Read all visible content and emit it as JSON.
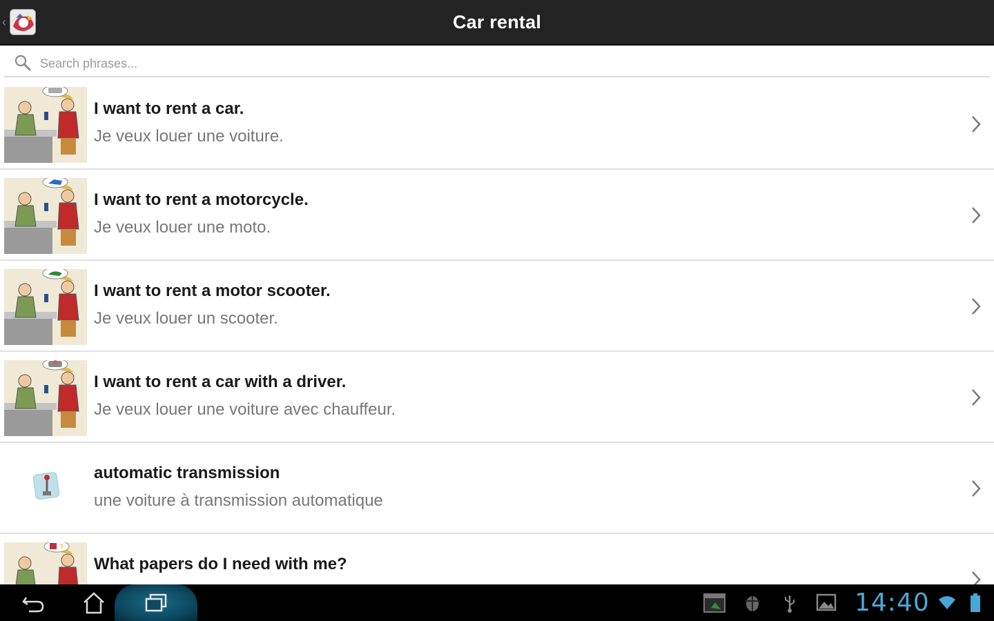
{
  "actionbar": {
    "title": "Car rental"
  },
  "search": {
    "placeholder": "Search phrases..."
  },
  "phrases": [
    {
      "en": "I want to rent a car.",
      "fr": "Je veux louer une voiture."
    },
    {
      "en": "I want to rent a motorcycle.",
      "fr": "Je veux louer une moto."
    },
    {
      "en": "I want to rent a motor scooter.",
      "fr": "Je veux louer un scooter."
    },
    {
      "en": "I want to rent a car with a driver.",
      "fr": "Je veux louer une voiture avec chauffeur."
    },
    {
      "en": "automatic transmission",
      "fr": "une voiture à transmission automatique"
    },
    {
      "en": "What papers do I need with me?",
      "fr": ""
    }
  ],
  "statusbar": {
    "time": "14:40",
    "accent": "#4aa6d6"
  }
}
